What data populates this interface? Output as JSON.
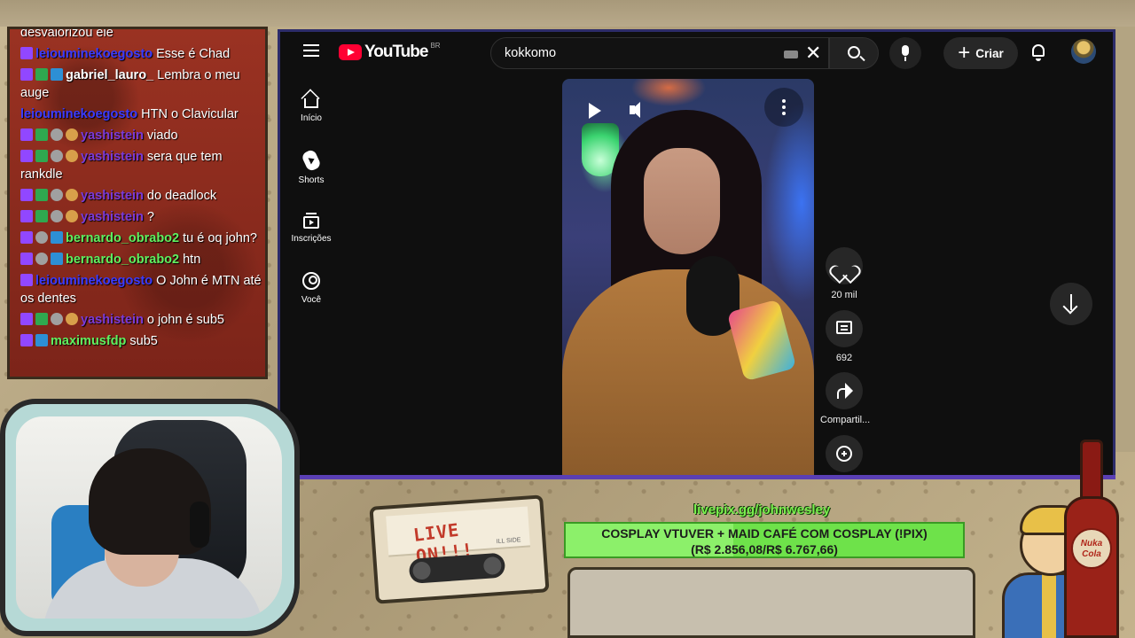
{
  "chat": {
    "messages": [
      {
        "user": "",
        "user_color": "#ffffff",
        "text": "desvalorizou ele",
        "badges": []
      },
      {
        "user": "leiouminekoegosto",
        "user_color": "#3b3bff",
        "text": "Esse é Chad",
        "badges": [
          "twitch"
        ]
      },
      {
        "user": "gabriel_lauro_",
        "user_color": "#ffffff",
        "text": "Lembra o meu auge",
        "badges": [
          "twitch",
          "check",
          "blue"
        ]
      },
      {
        "user": "leiouminekoegosto",
        "user_color": "#3b3bff",
        "text": "HTN o Clavicular",
        "badges": []
      },
      {
        "user": "yashistein",
        "user_color": "#7a3ad8",
        "text": "viado",
        "badges": [
          "twitch",
          "check",
          "star",
          "face"
        ]
      },
      {
        "user": "yashistein",
        "user_color": "#7a3ad8",
        "text": "sera que tem rankdle",
        "badges": [
          "twitch",
          "check",
          "star",
          "face"
        ]
      },
      {
        "user": "yashistein",
        "user_color": "#7a3ad8",
        "text": "do deadlock",
        "badges": [
          "twitch",
          "check",
          "star",
          "face"
        ]
      },
      {
        "user": "yashistein",
        "user_color": "#7a3ad8",
        "text": "?",
        "badges": [
          "twitch",
          "check",
          "star",
          "face"
        ]
      },
      {
        "user": "bernardo_obrabo2",
        "user_color": "#5ff05f",
        "text": "tu é oq john?",
        "badges": [
          "twitch",
          "star",
          "blue"
        ]
      },
      {
        "user": "bernardo_obrabo2",
        "user_color": "#5ff05f",
        "text": "htn",
        "badges": [
          "twitch",
          "star",
          "blue"
        ]
      },
      {
        "user": "leiouminekoegosto",
        "user_color": "#3b3bff",
        "text": "O John é MTN até os dentes",
        "badges": [
          "twitch"
        ]
      },
      {
        "user": "yashistein",
        "user_color": "#7a3ad8",
        "text": "o john é sub5",
        "badges": [
          "twitch",
          "check",
          "star",
          "face"
        ]
      },
      {
        "user": "maximusfdp",
        "user_color": "#5ff05f",
        "text": "sub5",
        "badges": [
          "twitch",
          "blue"
        ]
      }
    ]
  },
  "youtube": {
    "logo_text": "YouTube",
    "country_code": "BR",
    "search_value": "kokkomo",
    "create_label": "Criar",
    "sidebar": [
      {
        "label": "Início",
        "icon": "home-icon"
      },
      {
        "label": "Shorts",
        "icon": "shorts-icon"
      },
      {
        "label": "Inscrições",
        "icon": "subscriptions-icon"
      },
      {
        "label": "Você",
        "icon": "you-icon"
      }
    ],
    "actions": {
      "likes": "20 mil",
      "comments": "692",
      "share": "Compartil..."
    }
  },
  "overlay": {
    "tape_text": "LIVE ON!!!",
    "tape_sub": "ILL SIDE",
    "livepix": "livepix.gg/johnwesley",
    "goal_title": "COSPLAY VTUVER + MAID CAFÉ COM COSPLAY (!PIX)",
    "goal_progress": "(R$ 2.856,08/R$ 6.767,66)",
    "goal_fraction": 0.422,
    "bottle_text": "Nuka Cola"
  },
  "colors": {
    "youtube_red": "#ff0033",
    "goal_green": "#6ee24a",
    "chat_bg": "#8e2a1e"
  }
}
